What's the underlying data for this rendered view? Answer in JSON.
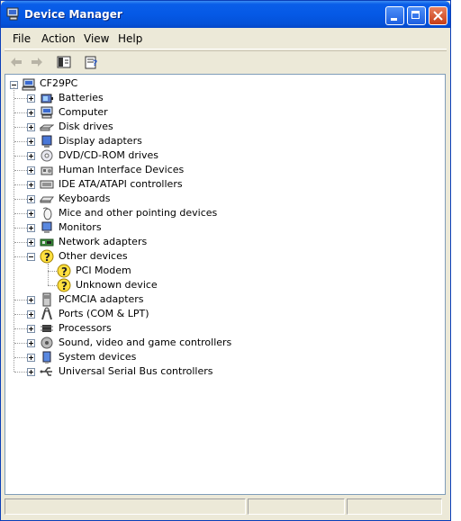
{
  "window": {
    "title": "Device Manager"
  },
  "menu": {
    "file": "File",
    "action": "Action",
    "view": "View",
    "help": "Help"
  },
  "tree": {
    "root": "CF29PC",
    "categories": [
      {
        "label": "Batteries",
        "icon": "battery-icon"
      },
      {
        "label": "Computer",
        "icon": "computer-icon"
      },
      {
        "label": "Disk drives",
        "icon": "disk-drive-icon"
      },
      {
        "label": "Display adapters",
        "icon": "display-adapter-icon"
      },
      {
        "label": "DVD/CD-ROM drives",
        "icon": "dvd-drive-icon"
      },
      {
        "label": "Human Interface Devices",
        "icon": "hid-icon"
      },
      {
        "label": "IDE ATA/ATAPI controllers",
        "icon": "ide-controller-icon"
      },
      {
        "label": "Keyboards",
        "icon": "keyboard-icon"
      },
      {
        "label": "Mice and other pointing devices",
        "icon": "mouse-icon"
      },
      {
        "label": "Monitors",
        "icon": "monitor-icon"
      },
      {
        "label": "Network adapters",
        "icon": "network-adapter-icon"
      },
      {
        "label": "Other devices",
        "icon": "unknown-device-icon",
        "expanded": true,
        "children": [
          {
            "label": "PCI Modem"
          },
          {
            "label": "Unknown device"
          }
        ]
      },
      {
        "label": "PCMCIA adapters",
        "icon": "pcmcia-icon"
      },
      {
        "label": "Ports (COM & LPT)",
        "icon": "port-icon"
      },
      {
        "label": "Processors",
        "icon": "processor-icon"
      },
      {
        "label": "Sound, video and game controllers",
        "icon": "sound-icon"
      },
      {
        "label": "System devices",
        "icon": "system-device-icon"
      },
      {
        "label": "Universal Serial Bus controllers",
        "icon": "usb-icon"
      }
    ]
  },
  "colors": {
    "titlebar": "#0559e6",
    "close_button": "#c73d17",
    "window_bg": "#ece9d8"
  }
}
